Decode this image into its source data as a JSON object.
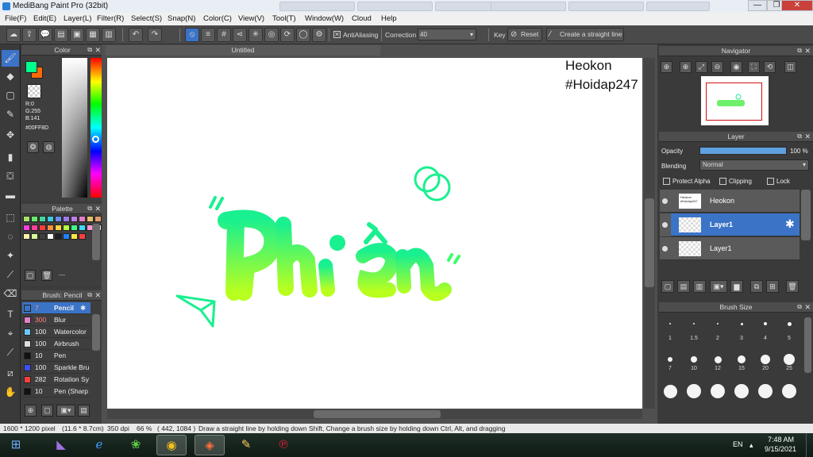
{
  "window": {
    "title": "MediBang Paint Pro (32bit)",
    "min": "—",
    "max": "❐",
    "close": "✕"
  },
  "menu": [
    "File(F)",
    "Edit(E)",
    "Layer(L)",
    "Filter(R)",
    "Select(S)",
    "Snap(N)",
    "Color(C)",
    "View(V)",
    "Tool(T)",
    "Window(W)",
    "Cloud",
    "Help"
  ],
  "toolbar": {
    "antialiasing_label": "AntiAliasing",
    "correction_label": "Correction",
    "correction_value": "40",
    "key_label": "Key",
    "reset_label": "Reset",
    "straight_line_label": "Create a straight line"
  },
  "color_panel": {
    "title": "Color",
    "r": "R:0",
    "g": "G:255",
    "b": "B:141",
    "hex": "#00FF8D",
    "primary": "#00ff8d",
    "secondary": "#ff6a00"
  },
  "palette_panel": {
    "title": "Palette",
    "swatches": [
      "#a5e36c",
      "#6ce86c",
      "#44d59a",
      "#3fc6e3",
      "#6c8cf0",
      "#9c7be6",
      "#c07ee6",
      "#e37ec6",
      "#e3c26c",
      "#e39a6c",
      "#ff3fe0",
      "#ff3f9a",
      "#ff3f3f",
      "#ff8c3f",
      "#ffd23f",
      "#b5ff3f",
      "#3fff8c",
      "#3fd9ff",
      "#ff9ad9",
      "#ffd9ef",
      "#fff2a8",
      "#d9ff9a",
      "#3f3f3f",
      "#ffffff",
      "#1f1f1f",
      "#1f7fff",
      "#ffe63f",
      "#ff3f3f"
    ],
    "more": "---"
  },
  "brush_panel": {
    "title": "Brush: Pencil",
    "items": [
      {
        "size": "7",
        "name": "Pencil",
        "color": "#3b74c7"
      },
      {
        "size": "300",
        "name": "Blur",
        "color": "#e87ec6"
      },
      {
        "size": "100",
        "name": "Watercolor",
        "color": "#6cc6ff"
      },
      {
        "size": "100",
        "name": "Airbrush",
        "color": "#dddddd"
      },
      {
        "size": "10",
        "name": "Pen",
        "color": "#111111"
      },
      {
        "size": "100",
        "name": "Sparkle Bru",
        "color": "#3f4fff"
      },
      {
        "size": "282",
        "name": "Rotation Sy",
        "color": "#ff3f3f"
      },
      {
        "size": "10",
        "name": "Pen (Sharp",
        "color": "#111111"
      }
    ]
  },
  "canvas": {
    "doc_tab": "Untitled",
    "watermark_line1": "Heokon",
    "watermark_line2": "#Hoidap247",
    "lettering": "Phiền",
    "stroke_color": "#19f08f",
    "fill_color": "#9dff2b"
  },
  "navigator": {
    "title": "Navigator"
  },
  "layer_panel": {
    "title": "Layer",
    "opacity_label": "Opacity",
    "opacity_value": "100 %",
    "opacity": 1.0,
    "blending_label": "Blending",
    "blending_value": "Normal",
    "protect_alpha": "Protect Alpha",
    "clipping": "Clipping",
    "lock": "Lock",
    "layers": [
      {
        "name": "Heokon",
        "thumb_text": "Heokon #Hoidap247"
      },
      {
        "name": "Layer1"
      },
      {
        "name": "Layer1"
      }
    ]
  },
  "brush_size_panel": {
    "title": "Brush Size",
    "sizes": [
      "1",
      "1.5",
      "2",
      "3",
      "4",
      "5",
      "7",
      "10",
      "12",
      "15",
      "20",
      "25",
      "30",
      "40",
      "50",
      "70",
      "100",
      "150"
    ]
  },
  "status": {
    "size": "1600 * 1200 pixel",
    "cm": "(11.6 * 8.7cm)",
    "dpi": "350 dpi",
    "zoom": "66 %",
    "coords": "( 442, 1084 )",
    "hint": "Draw a straight line by holding down Shift, Change a brush size by holding down Ctrl, Alt, and dragging"
  },
  "taskbar": {
    "lang": "EN",
    "time": "7:48 AM",
    "date": "9/15/2021"
  }
}
